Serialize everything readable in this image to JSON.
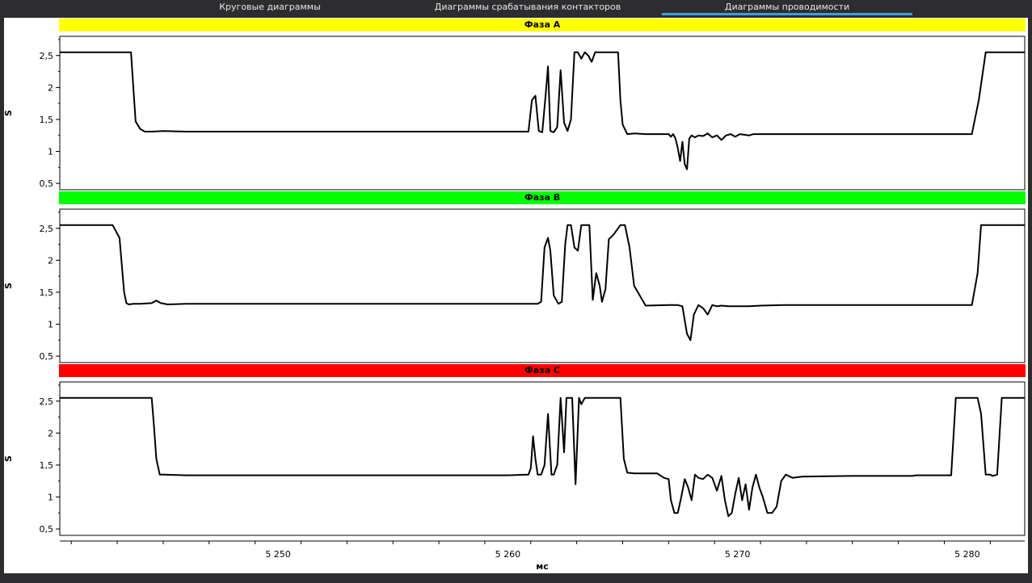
{
  "tabs": [
    {
      "label": "Круговые диаграммы",
      "active": false
    },
    {
      "label": "Диаграммы срабатывания контакторов",
      "active": false
    },
    {
      "label": "Диаграммы проводимости",
      "active": true
    }
  ],
  "colors": {
    "accent": "#3aa0d8",
    "phase_a": "#ffff00",
    "phase_b": "#00ff00",
    "phase_c": "#ff0000",
    "trace": "#000000"
  },
  "x_axis": {
    "label": "мс",
    "ticks": [
      "5 250",
      "5 260",
      "5 270",
      "5 280"
    ],
    "tick_values": [
      5250,
      5260,
      5270,
      5280
    ],
    "range": [
      5240.5,
      5282.5
    ]
  },
  "chart_data": [
    {
      "type": "line",
      "title": "Фаза A",
      "ylabel": "S",
      "ylim": [
        0.4,
        2.8
      ],
      "yticks": [
        "0,5",
        "1",
        "1,5",
        "2",
        "2,5"
      ],
      "ytick_values": [
        0.5,
        1,
        1.5,
        2,
        2.5
      ],
      "x": [
        5240.5,
        5243.6,
        5243.7,
        5243.8,
        5244,
        5244.2,
        5244.5,
        5245,
        5246,
        5248,
        5250,
        5255,
        5260,
        5260.9,
        5261.05,
        5261.2,
        5261.35,
        5261.5,
        5261.65,
        5261.75,
        5261.85,
        5262,
        5262.15,
        5262.3,
        5262.45,
        5262.6,
        5262.75,
        5262.9,
        5263.05,
        5263.2,
        5263.35,
        5263.5,
        5263.65,
        5263.8,
        5264,
        5264.5,
        5264.8,
        5264.9,
        5265,
        5265.2,
        5265.5,
        5266,
        5266.5,
        5267,
        5267.1,
        5267.2,
        5267.3,
        5267.4,
        5267.5,
        5267.6,
        5267.7,
        5267.8,
        5267.9,
        5268,
        5268.15,
        5268.3,
        5268.5,
        5268.7,
        5268.9,
        5269.1,
        5269.3,
        5269.5,
        5269.7,
        5269.9,
        5270.1,
        5270.3,
        5270.5,
        5270.7,
        5271,
        5271.5,
        5272,
        5275,
        5278,
        5280.2,
        5280.5,
        5280.8,
        5282.5
      ],
      "y": [
        2.55,
        2.55,
        2.0,
        1.47,
        1.35,
        1.31,
        1.31,
        1.32,
        1.31,
        1.31,
        1.31,
        1.31,
        1.31,
        1.31,
        1.8,
        1.87,
        1.32,
        1.3,
        1.9,
        2.33,
        1.32,
        1.3,
        1.38,
        2.27,
        1.45,
        1.32,
        1.5,
        2.55,
        2.55,
        2.45,
        2.55,
        2.5,
        2.4,
        2.55,
        2.55,
        2.55,
        2.55,
        1.8,
        1.42,
        1.27,
        1.28,
        1.27,
        1.27,
        1.27,
        1.23,
        1.27,
        1.2,
        1.05,
        0.85,
        1.15,
        0.8,
        0.72,
        1.2,
        1.25,
        1.22,
        1.25,
        1.24,
        1.28,
        1.22,
        1.25,
        1.18,
        1.25,
        1.27,
        1.23,
        1.27,
        1.26,
        1.25,
        1.27,
        1.27,
        1.27,
        1.27,
        1.27,
        1.27,
        1.27,
        1.8,
        2.55,
        2.55
      ]
    },
    {
      "type": "line",
      "title": "Фаза B",
      "ylabel": "S",
      "ylim": [
        0.4,
        2.8
      ],
      "yticks": [
        "0,5",
        "1",
        "1,5",
        "2",
        "2,5"
      ],
      "ytick_values": [
        0.5,
        1,
        1.5,
        2,
        2.5
      ],
      "x": [
        5240.5,
        5242.8,
        5243.1,
        5243.3,
        5243.4,
        5243.5,
        5243.7,
        5244,
        5244.5,
        5244.7,
        5244.9,
        5245.2,
        5246,
        5250,
        5255,
        5260,
        5261.3,
        5261.45,
        5261.6,
        5261.75,
        5261.85,
        5262,
        5262.2,
        5262.35,
        5262.5,
        5262.6,
        5262.75,
        5262.9,
        5263.05,
        5263.2,
        5263.4,
        5263.55,
        5263.7,
        5263.85,
        5264,
        5264.1,
        5264.25,
        5264.4,
        5264.6,
        5264.9,
        5265.1,
        5265.3,
        5265.5,
        5266,
        5267,
        5267.4,
        5267.6,
        5267.8,
        5267.95,
        5268.1,
        5268.3,
        5268.5,
        5268.7,
        5268.9,
        5269.1,
        5269.3,
        5269.6,
        5270,
        5270.5,
        5271,
        5272,
        5275,
        5278,
        5280.2,
        5280.45,
        5280.6,
        5282.5
      ],
      "y": [
        2.55,
        2.55,
        2.35,
        1.5,
        1.33,
        1.31,
        1.32,
        1.32,
        1.33,
        1.37,
        1.33,
        1.31,
        1.32,
        1.32,
        1.32,
        1.32,
        1.32,
        1.35,
        2.2,
        2.35,
        2.15,
        1.45,
        1.32,
        1.35,
        2.25,
        2.55,
        2.55,
        2.2,
        2.15,
        2.55,
        2.55,
        2.55,
        1.38,
        1.8,
        1.6,
        1.35,
        1.55,
        2.33,
        2.4,
        2.55,
        2.55,
        2.2,
        1.6,
        1.29,
        1.3,
        1.3,
        1.28,
        0.85,
        0.75,
        1.15,
        1.3,
        1.25,
        1.15,
        1.3,
        1.28,
        1.29,
        1.28,
        1.28,
        1.28,
        1.29,
        1.3,
        1.3,
        1.3,
        1.3,
        1.8,
        2.55,
        2.55
      ]
    },
    {
      "type": "line",
      "title": "Фаза C",
      "ylabel": "S",
      "ylim": [
        0.4,
        2.8
      ],
      "yticks": [
        "0,5",
        "1",
        "1,5",
        "2",
        "2,5"
      ],
      "ytick_values": [
        0.5,
        1,
        1.5,
        2,
        2.5
      ],
      "x": [
        5240.5,
        5244.5,
        5244.6,
        5244.7,
        5244.85,
        5245,
        5246,
        5250,
        5255,
        5260,
        5260.9,
        5261,
        5261.1,
        5261.2,
        5261.3,
        5261.45,
        5261.6,
        5261.75,
        5261.9,
        5262,
        5262.15,
        5262.3,
        5262.45,
        5262.55,
        5262.65,
        5262.8,
        5262.95,
        5263.1,
        5263.2,
        5263.35,
        5263.5,
        5263.65,
        5263.85,
        5264,
        5264.5,
        5264.9,
        5265.05,
        5265.2,
        5265.5,
        5266,
        5266.5,
        5266.8,
        5267,
        5267.1,
        5267.25,
        5267.4,
        5267.55,
        5267.7,
        5267.85,
        5268,
        5268.15,
        5268.3,
        5268.5,
        5268.7,
        5268.9,
        5269.1,
        5269.3,
        5269.45,
        5269.6,
        5269.75,
        5269.9,
        5270.05,
        5270.2,
        5270.35,
        5270.5,
        5270.65,
        5270.8,
        5270.95,
        5271.1,
        5271.3,
        5271.5,
        5271.7,
        5271.9,
        5272.1,
        5272.4,
        5272.8,
        5275,
        5277.6,
        5277.8,
        5278,
        5279.1,
        5279.3,
        5279.5,
        5280.1,
        5280.3,
        5280.45,
        5280.6,
        5280.8,
        5281,
        5281.1,
        5281.3,
        5281.5,
        5282.5
      ],
      "y": [
        2.55,
        2.55,
        2.1,
        1.6,
        1.35,
        1.35,
        1.34,
        1.34,
        1.34,
        1.34,
        1.35,
        1.45,
        1.95,
        1.6,
        1.35,
        1.35,
        1.5,
        2.3,
        1.35,
        1.35,
        1.5,
        2.55,
        1.7,
        2.55,
        2.55,
        2.55,
        1.2,
        2.55,
        2.45,
        2.55,
        2.55,
        2.55,
        2.55,
        2.55,
        2.55,
        2.55,
        1.6,
        1.38,
        1.37,
        1.37,
        1.37,
        1.3,
        1.28,
        0.95,
        0.75,
        0.75,
        1.0,
        1.28,
        1.15,
        0.95,
        1.35,
        1.3,
        1.28,
        1.35,
        1.3,
        1.1,
        1.33,
        0.95,
        0.7,
        0.75,
        1.05,
        1.3,
        0.95,
        1.2,
        0.8,
        1.15,
        1.35,
        1.15,
        1.0,
        0.75,
        0.75,
        0.85,
        1.25,
        1.35,
        1.3,
        1.32,
        1.33,
        1.33,
        1.34,
        1.34,
        1.34,
        1.34,
        2.55,
        2.55,
        2.55,
        2.55,
        2.3,
        1.35,
        1.35,
        1.33,
        1.35,
        2.55,
        2.55
      ]
    }
  ]
}
